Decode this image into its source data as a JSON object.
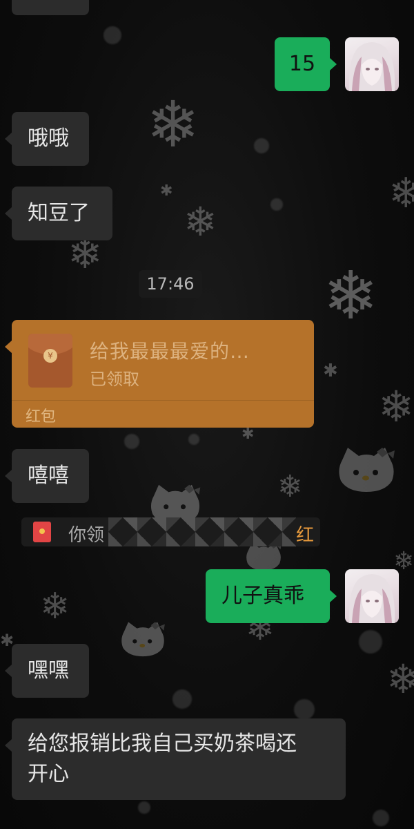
{
  "messages": {
    "out_1": "15",
    "in_1": "哦哦",
    "in_2": "知豆了",
    "in_3": "嘻嘻",
    "out_2": "儿子真乖",
    "in_4": "嘿嘿",
    "in_5_line1": "给您报销比我自己买奶茶喝还",
    "in_5_line2": "开心"
  },
  "timestamp": "17:46",
  "red_packet": {
    "title": "给我最最最爱的…",
    "status": "已领取",
    "label": "红包"
  },
  "system_notice": {
    "prefix": "你领",
    "suffix": "红包"
  },
  "colors": {
    "outgoing_bubble": "#1aad5a",
    "incoming_bubble": "#2c2c2c",
    "red_packet": "#b5722a",
    "notice_accent": "#e79a3c"
  },
  "icons": {
    "red_packet_icon": "red-envelope",
    "mini_red_packet": "red-envelope-small"
  }
}
